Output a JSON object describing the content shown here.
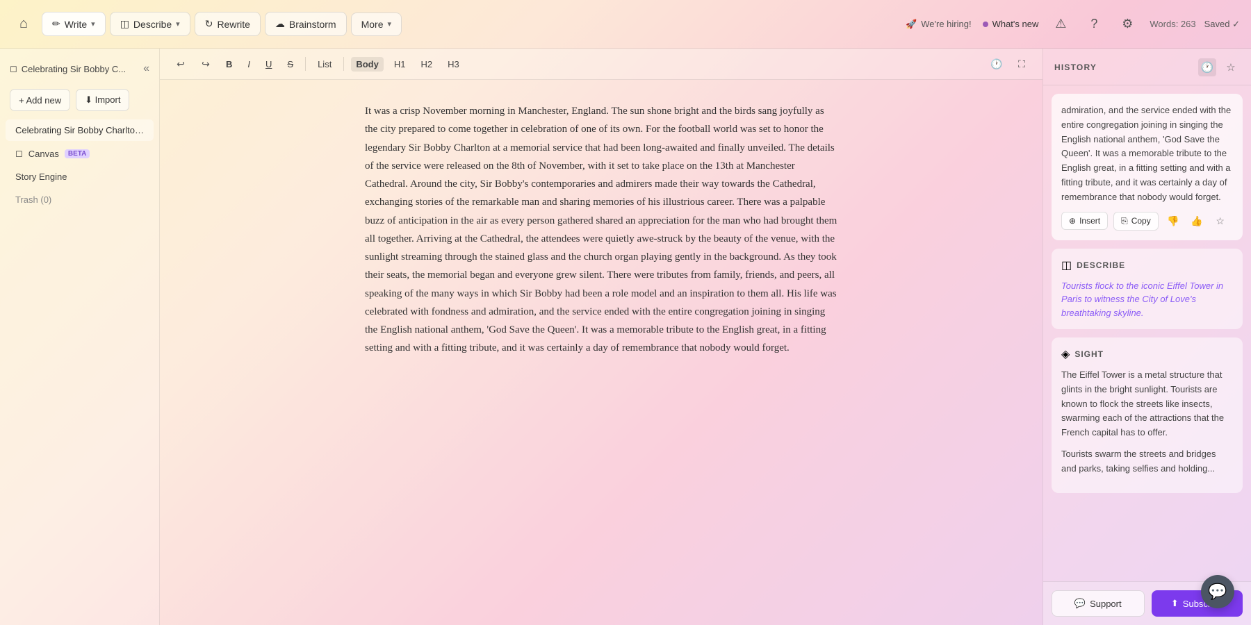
{
  "nav": {
    "home_icon": "⌂",
    "write_label": "Write",
    "describe_label": "Describe",
    "rewrite_label": "Rewrite",
    "brainstorm_label": "Brainstorm",
    "more_label": "More",
    "hiring_label": "We're hiring!",
    "whats_new_label": "What's new",
    "words_label": "Words: 263",
    "saved_label": "Saved ✓"
  },
  "sidebar": {
    "doc_title": "Celebrating Sir Bobby C...",
    "add_new_label": "+ Add new",
    "import_label": "⬇ Import",
    "doc_item_label": "Celebrating Sir Bobby Charlton's L...",
    "canvas_label": "Canvas",
    "canvas_badge": "BETA",
    "story_engine_label": "Story Engine",
    "trash_label": "Trash (0)"
  },
  "toolbar": {
    "undo": "↩",
    "redo": "↪",
    "bold": "B",
    "italic": "I",
    "underline": "U",
    "strikethrough": "S",
    "list": "List",
    "body": "Body",
    "h1": "H1",
    "h2": "H2",
    "h3": "H3"
  },
  "editor": {
    "content": "It was a crisp November morning in Manchester, England. The sun shone bright and the birds sang joyfully as the city prepared to come together in celebration of one of its own. For the football world was set to honor the legendary Sir Bobby Charlton at a memorial service that had been long-awaited and finally unveiled. The details of the service were released on the 8th of November, with it set to take place on the 13th at Manchester Cathedral. Around the city, Sir Bobby's contemporaries and admirers made their way towards the Cathedral, exchanging stories of the remarkable man and sharing memories of his illustrious career. There was a palpable buzz of anticipation in the air as every person gathered shared an appreciation for the man who had brought them all together. Arriving at the Cathedral, the attendees were quietly awe-struck by the beauty of the venue, with the sunlight streaming through the stained glass and the church organ playing gently in the background. As they took their seats, the memorial began and everyone grew silent. There were tributes from family, friends, and peers, all speaking of the many ways in which Sir Bobby had been a role model and an inspiration to them all. His life was celebrated with fondness and admiration, and the service ended with the entire congregation joining in singing the English national anthem, 'God Save the Queen'. It was a memorable tribute to the English great, in a fitting setting and with a fitting tribute, and it was certainly a day of remembrance that nobody would forget."
  },
  "history": {
    "title": "HISTORY",
    "history_icon": "🕐",
    "star_icon": "★",
    "card1_text": "admiration, and the service ended with the entire congregation joining in singing the English national anthem, 'God Save the Queen'.\n\nIt was a memorable tribute to the English great, in a fitting setting and with a fitting tribute, and it was certainly a day of remembrance that nobody would forget.",
    "insert_label": "Insert",
    "copy_label": "Copy",
    "describe_section_label": "DESCRIBE",
    "describe_prompt": "Tourists flock to the iconic Eiffel Tower in Paris to witness the City of Love's breathtaking skyline.",
    "sight_section_label": "SIGHT",
    "sight_text1": "The Eiffel Tower is a metal structure that glints in the bright sunlight. Tourists are known to flock the streets like insects, swarming each of the attractions that the French capital has to offer.",
    "sight_text2": "Tourists swarm the streets and bridges and parks, taking selfies and holding..."
  },
  "footer": {
    "support_label": "Support",
    "subscribe_label": "Subscribe"
  },
  "chat": {
    "icon": "💬"
  }
}
